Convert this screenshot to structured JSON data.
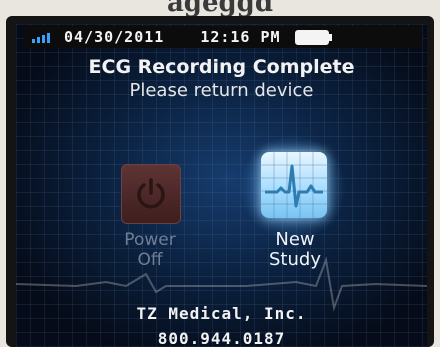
{
  "caption": {
    "text": "ageggd"
  },
  "status_bar": {
    "signal_icon": "signal-bars-icon",
    "date": "04/30/2011",
    "time": "12:16 PM",
    "battery_icon": "battery-full-icon"
  },
  "header": {
    "title": "ECG Recording Complete",
    "subtitle": "Please return device"
  },
  "buttons": {
    "power_off": {
      "icon": "power-icon",
      "line1": "Power",
      "line2": "Off",
      "state": "disabled"
    },
    "new_study": {
      "icon": "ecg-waveform-icon",
      "line1": "New",
      "line2": "Study",
      "state": "highlighted"
    }
  },
  "footer": {
    "company": "TZ Medical, Inc.",
    "phone": "800.944.0187"
  },
  "colors": {
    "screen_bg": "#0a1f3c",
    "accent": "#78c4f2",
    "disabled_button": "#5e3434",
    "disabled_text": "#6f7f95"
  }
}
